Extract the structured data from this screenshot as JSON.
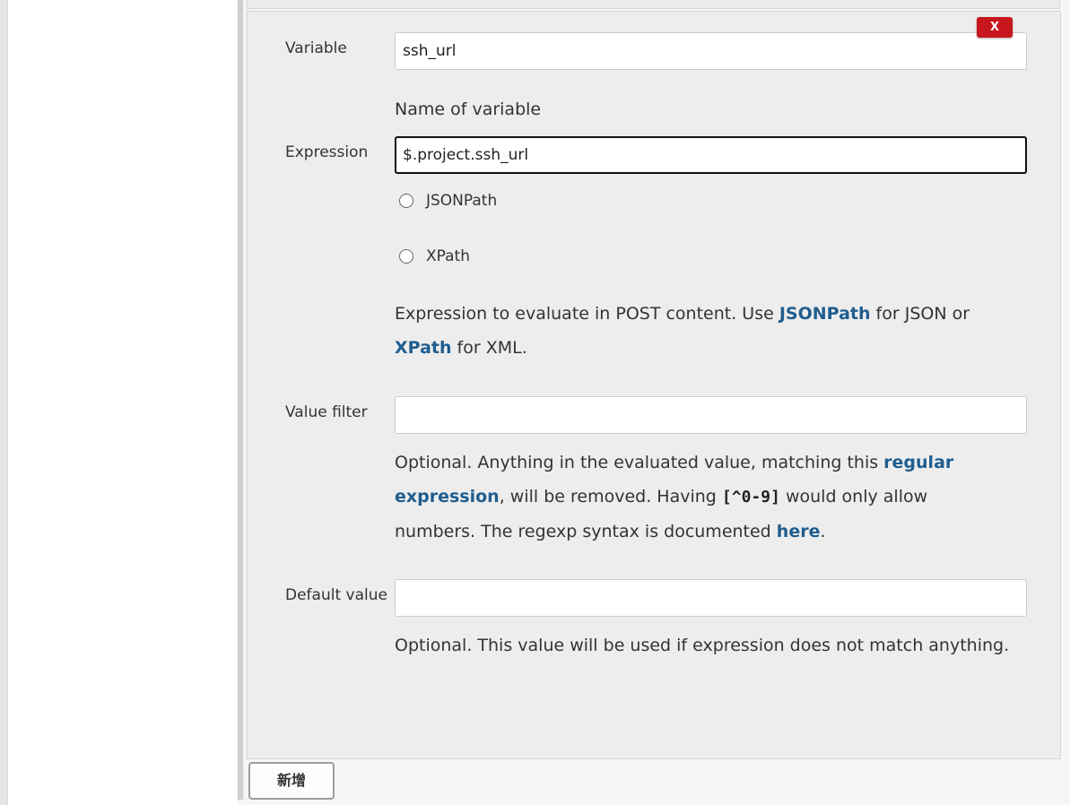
{
  "form": {
    "delete_label": "X",
    "variable": {
      "label": "Variable",
      "value": "ssh_url",
      "help": "Name of variable"
    },
    "expression": {
      "label": "Expression",
      "value": "$.project.ssh_url",
      "options": [
        {
          "label": "JSONPath",
          "selected": false
        },
        {
          "label": "XPath",
          "selected": false
        }
      ],
      "help": {
        "part1": "Expression to evaluate in POST content. Use ",
        "link1": "JSONPath",
        "part2": " for JSON or ",
        "link2": "XPath",
        "part3": " for XML."
      }
    },
    "value_filter": {
      "label": "Value filter",
      "value": "",
      "help": {
        "part1": "Optional. Anything in the evaluated value, matching this ",
        "link1": "regular expression",
        "part2": ", will be removed. Having ",
        "code": "[^0-9]",
        "part3": " would only allow numbers. The regexp syntax is documented ",
        "link2": "here",
        "part4": "."
      }
    },
    "default_value": {
      "label": "Default value",
      "value": "",
      "help": "Optional. This value will be used if expression does not match anything."
    }
  },
  "add_button_label": "新增",
  "colors": {
    "link": "#1f5d8f",
    "delete": "#c8161d",
    "card_bg": "#ededed"
  }
}
